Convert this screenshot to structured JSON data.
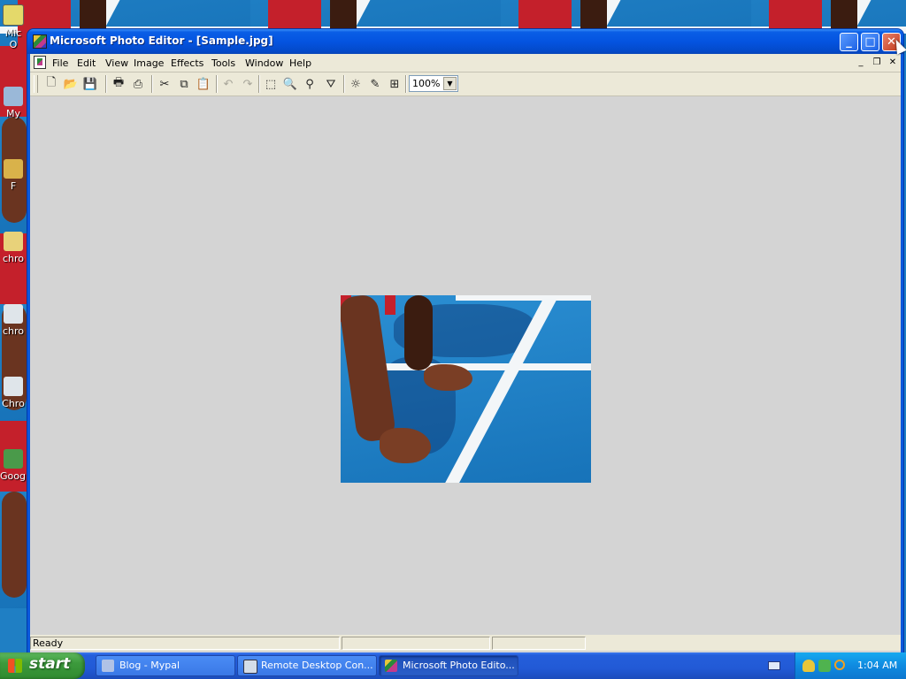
{
  "desktop": {
    "icons": [
      {
        "label": "Mic O",
        "icon": "outlook-icon"
      },
      {
        "label": "My",
        "icon": "my-computer-icon"
      },
      {
        "label": "F",
        "icon": "folder-icon"
      },
      {
        "label": "chro",
        "icon": "chrome-icon"
      },
      {
        "label": "chro",
        "icon": "chrome-icon"
      },
      {
        "label": "Chro",
        "icon": "chrome-icon"
      },
      {
        "label": "Googl",
        "icon": "google-icon"
      }
    ]
  },
  "window": {
    "title": "Microsoft Photo Editor - [Sample.jpg]",
    "app_icon": "photo-editor-icon",
    "caption_buttons": {
      "minimize": "_",
      "maximize": "□",
      "close": "✕"
    }
  },
  "menubar": {
    "items": [
      "File",
      "Edit",
      "View",
      "Image",
      "Effects",
      "Tools",
      "Window",
      "Help"
    ],
    "mdi_buttons": {
      "minimize": "_",
      "restore": "❐",
      "close": "✕"
    }
  },
  "toolbar": {
    "buttons": [
      {
        "name": "new-icon",
        "glyph": "🗋",
        "enabled": true
      },
      {
        "name": "open-icon",
        "glyph": "📂",
        "enabled": true
      },
      {
        "name": "save-icon",
        "glyph": "💾",
        "enabled": false
      },
      {
        "name": "print-icon",
        "glyph": "🖶",
        "enabled": true
      },
      {
        "name": "scan-icon",
        "glyph": "⎙",
        "enabled": true
      },
      {
        "name": "cut-icon",
        "glyph": "✂",
        "enabled": true
      },
      {
        "name": "copy-icon",
        "glyph": "⧉",
        "enabled": true
      },
      {
        "name": "paste-icon",
        "glyph": "📋",
        "enabled": false
      },
      {
        "name": "undo-icon",
        "glyph": "↶",
        "enabled": false
      },
      {
        "name": "redo-icon",
        "glyph": "↷",
        "enabled": false
      },
      {
        "name": "select-icon",
        "glyph": "⬚",
        "enabled": true
      },
      {
        "name": "zoom-icon",
        "glyph": "🔍",
        "enabled": true
      },
      {
        "name": "smudge-icon",
        "glyph": "⚲",
        "enabled": true
      },
      {
        "name": "transparent-icon",
        "glyph": "⛛",
        "enabled": true
      },
      {
        "name": "balance-icon",
        "glyph": "☼",
        "enabled": true
      },
      {
        "name": "pen-icon",
        "glyph": "✎",
        "enabled": true
      },
      {
        "name": "properties-icon",
        "glyph": "⊞",
        "enabled": true
      }
    ],
    "zoom": "100%"
  },
  "document": {
    "image_name": "Sample.jpg"
  },
  "statusbar": {
    "text": "Ready",
    "panes": [
      "",
      "",
      ""
    ]
  },
  "taskbar": {
    "start_label": "start",
    "tasks": [
      {
        "label": "Blog - Mypal",
        "icon": "mypal-icon",
        "active": false
      },
      {
        "label": "Remote Desktop Con...",
        "icon": "remote-desktop-icon",
        "active": false
      },
      {
        "label": "Microsoft Photo Edito...",
        "icon": "photo-editor-icon",
        "active": true
      }
    ],
    "clock": "1:04 AM"
  },
  "colors": {
    "title_bar": "#0454e0",
    "workspace": "#d4d4d4",
    "taskbar": "#245edb",
    "start_green": "#3c9a3c",
    "track_blue": "#1f7fc4"
  }
}
